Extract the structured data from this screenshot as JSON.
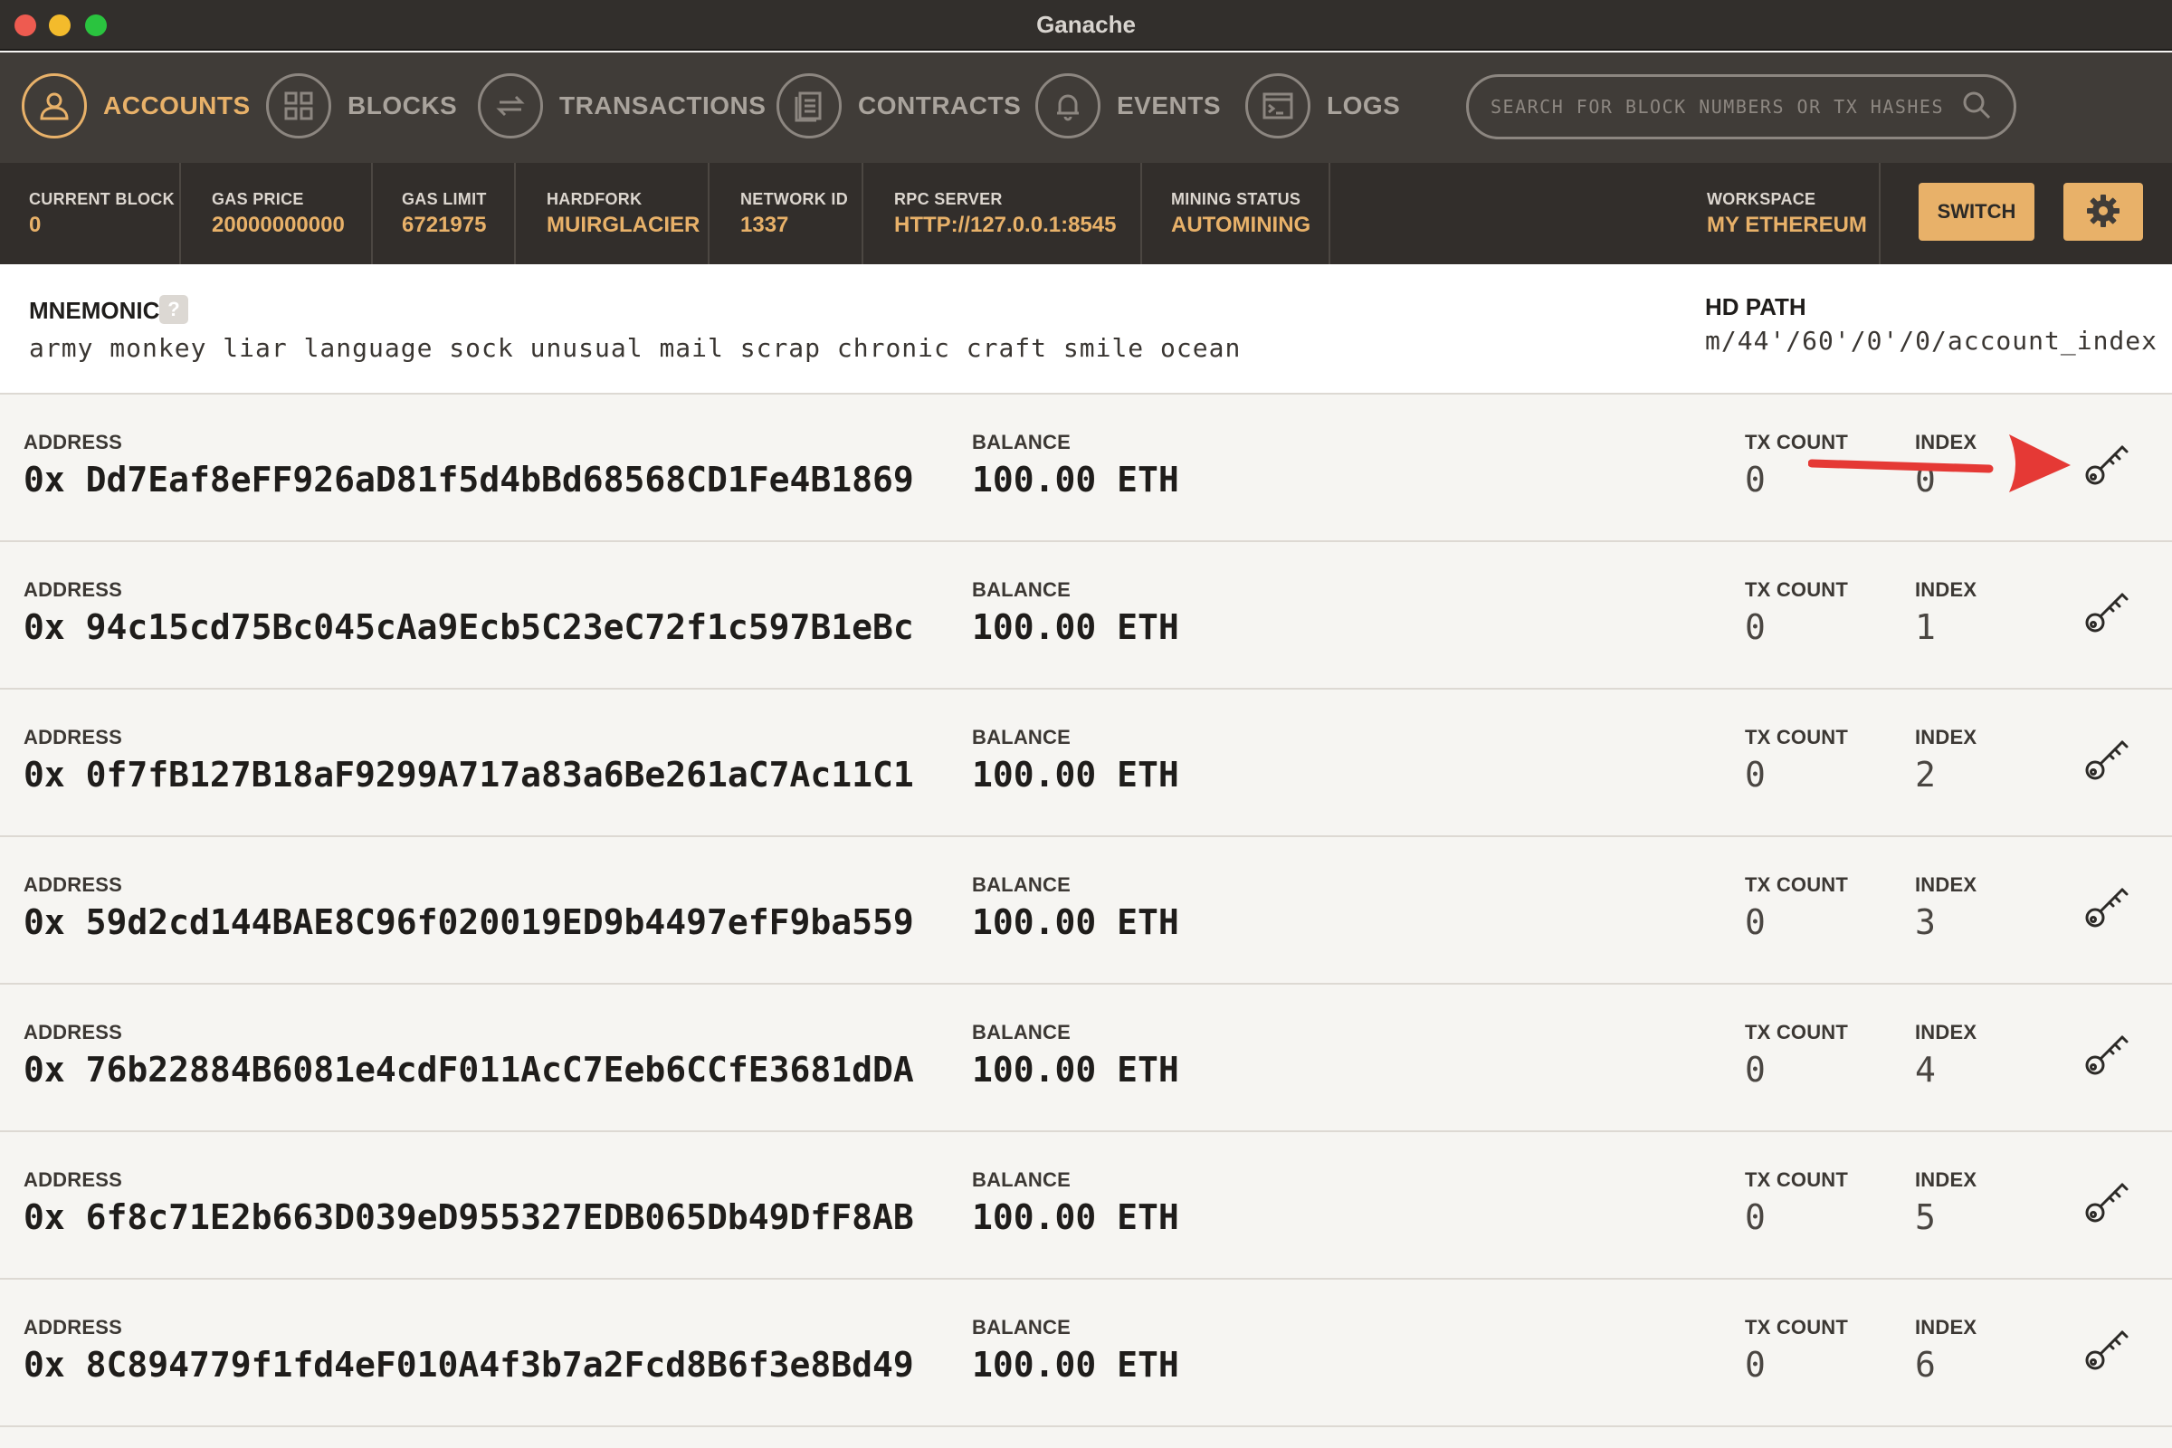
{
  "window": {
    "title": "Ganache"
  },
  "nav": {
    "items": [
      {
        "label": "ACCOUNTS",
        "icon": "user-icon",
        "active": true
      },
      {
        "label": "BLOCKS",
        "icon": "blocks-icon",
        "active": false
      },
      {
        "label": "TRANSACTIONS",
        "icon": "transactions-icon",
        "active": false
      },
      {
        "label": "CONTRACTS",
        "icon": "contracts-icon",
        "active": false
      },
      {
        "label": "EVENTS",
        "icon": "bell-icon",
        "active": false
      },
      {
        "label": "LOGS",
        "icon": "logs-icon",
        "active": false
      }
    ],
    "search_placeholder": "SEARCH FOR BLOCK NUMBERS OR TX HASHES"
  },
  "stats": {
    "current_block": {
      "label": "CURRENT BLOCK",
      "value": "0"
    },
    "gas_price": {
      "label": "GAS PRICE",
      "value": "20000000000"
    },
    "gas_limit": {
      "label": "GAS LIMIT",
      "value": "6721975"
    },
    "hardfork": {
      "label": "HARDFORK",
      "value": "MUIRGLACIER"
    },
    "network_id": {
      "label": "NETWORK ID",
      "value": "1337"
    },
    "rpc_server": {
      "label": "RPC SERVER",
      "value": "HTTP://127.0.0.1:8545"
    },
    "mining_status": {
      "label": "MINING STATUS",
      "value": "AUTOMINING"
    },
    "workspace": {
      "label": "WORKSPACE",
      "value": "MY ETHEREUM"
    },
    "switch_label": "SWITCH"
  },
  "mnemonic": {
    "label": "MNEMONIC",
    "help": "?",
    "words": "army monkey liar language sock unusual mail scrap chronic craft smile ocean",
    "hd_label": "HD PATH",
    "hd_path": "m/44'/60'/0'/0/account_index"
  },
  "labels": {
    "address": "ADDRESS",
    "balance": "BALANCE",
    "tx_count": "TX COUNT",
    "index": "INDEX"
  },
  "accounts": [
    {
      "address": "0x Dd7Eaf8eFF926aD81f5d4bBd68568CD1Fe4B1869",
      "balance": "100.00 ETH",
      "tx_count": "0",
      "index": "0"
    },
    {
      "address": "0x 94c15cd75Bc045cAa9Ecb5C23eC72f1c597B1eBc",
      "balance": "100.00 ETH",
      "tx_count": "0",
      "index": "1"
    },
    {
      "address": "0x 0f7fB127B18aF9299A717a83a6Be261aC7Ac11C1",
      "balance": "100.00 ETH",
      "tx_count": "0",
      "index": "2"
    },
    {
      "address": "0x 59d2cd144BAE8C96f020019ED9b4497efF9ba559",
      "balance": "100.00 ETH",
      "tx_count": "0",
      "index": "3"
    },
    {
      "address": "0x 76b22884B6081e4cdF011AcC7Eeb6CCfE3681dDA",
      "balance": "100.00 ETH",
      "tx_count": "0",
      "index": "4"
    },
    {
      "address": "0x 6f8c71E2b663D039eD955327EDB065Db49DfF8AB",
      "balance": "100.00 ETH",
      "tx_count": "0",
      "index": "5"
    },
    {
      "address": "0x 8C894779f1fd4eF010A4f3b7a2Fcd8B6f3e8Bd49",
      "balance": "100.00 ETH",
      "tx_count": "0",
      "index": "6"
    }
  ],
  "colors": {
    "accent": "#e8b169",
    "annotation_arrow": "#e53935"
  }
}
